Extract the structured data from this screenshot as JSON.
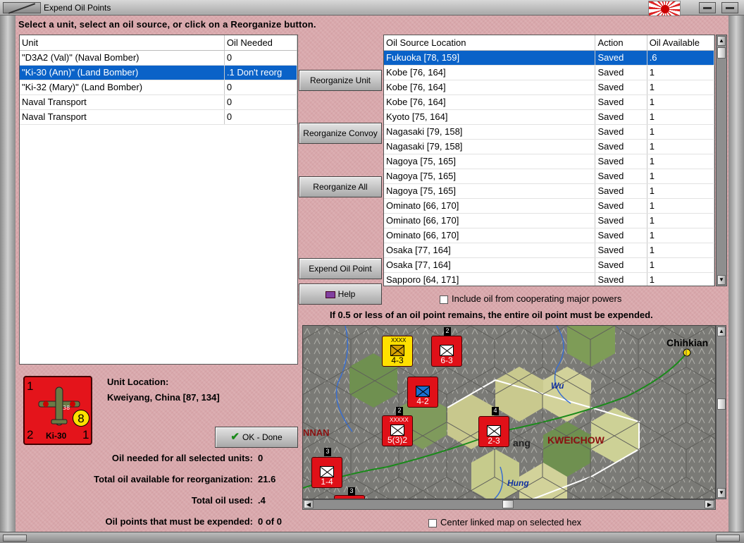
{
  "window": {
    "title": "Expend Oil Points"
  },
  "instruction": "Select a unit, select an oil source, or click on a Reorganize button.",
  "units_table": {
    "headers": [
      "Unit",
      "Oil Needed"
    ],
    "rows": [
      {
        "unit": "\"D3A2 (Val)\" (Naval Bomber)",
        "oil": "0"
      },
      {
        "unit": "\"Ki-30 (Ann)\" (Land Bomber)",
        "oil": ".1 Don't reorg"
      },
      {
        "unit": "\"Ki-32 (Mary)\" (Land Bomber)",
        "oil": "0"
      },
      {
        "unit": "Naval Transport",
        "oil": "0"
      },
      {
        "unit": "Naval Transport",
        "oil": "0"
      }
    ],
    "selected_index": 1
  },
  "buttons": {
    "reorganize_unit": "Reorganize Unit",
    "reorganize_convoy": "Reorganize Convoy",
    "reorganize_all": "Reorganize All",
    "expend_oil_point": "Expend Oil Point",
    "help": "Help",
    "ok_done": "OK - Done"
  },
  "oil_table": {
    "headers": [
      "Oil Source Location",
      "Action",
      "Oil Available"
    ],
    "rows": [
      {
        "loc": "Fukuoka [78, 159]",
        "action": "Saved",
        "avail": ".6"
      },
      {
        "loc": "Kobe [76, 164]",
        "action": "Saved",
        "avail": "1"
      },
      {
        "loc": "Kobe [76, 164]",
        "action": "Saved",
        "avail": "1"
      },
      {
        "loc": "Kobe [76, 164]",
        "action": "Saved",
        "avail": "1"
      },
      {
        "loc": "Kyoto [75, 164]",
        "action": "Saved",
        "avail": "1"
      },
      {
        "loc": "Nagasaki [79, 158]",
        "action": "Saved",
        "avail": "1"
      },
      {
        "loc": "Nagasaki [79, 158]",
        "action": "Saved",
        "avail": "1"
      },
      {
        "loc": "Nagoya [75, 165]",
        "action": "Saved",
        "avail": "1"
      },
      {
        "loc": "Nagoya [75, 165]",
        "action": "Saved",
        "avail": "1"
      },
      {
        "loc": "Nagoya [75, 165]",
        "action": "Saved",
        "avail": "1"
      },
      {
        "loc": "Ominato [66, 170]",
        "action": "Saved",
        "avail": "1"
      },
      {
        "loc": "Ominato [66, 170]",
        "action": "Saved",
        "avail": "1"
      },
      {
        "loc": "Ominato [66, 170]",
        "action": "Saved",
        "avail": "1"
      },
      {
        "loc": "Osaka [77, 164]",
        "action": "Saved",
        "avail": "1"
      },
      {
        "loc": "Osaka [77, 164]",
        "action": "Saved",
        "avail": "1"
      },
      {
        "loc": "Sapporo [64, 171]",
        "action": "Saved",
        "avail": "1"
      }
    ],
    "selected_index": 0
  },
  "include_cooperating": "Include oil from cooperating major powers",
  "note": "If 0.5 or less of an oil point remains, the entire oil point must be expended.",
  "unit_counter": {
    "tl": "1",
    "bl": "2",
    "br": "1",
    "circle": "8",
    "name": "Ki-30",
    "small": "38"
  },
  "unit_location": {
    "label": "Unit Location:",
    "value": "Kweiyang, China [87, 134]"
  },
  "stats": [
    {
      "label": "Oil needed for all selected units:",
      "value": "0"
    },
    {
      "label": "Total oil available for reorganization:",
      "value": "21.6"
    },
    {
      "label": "Total oil used:",
      "value": ".4"
    },
    {
      "label": "Oil points that must be expended:",
      "value": "0 of 0"
    }
  ],
  "map": {
    "labels": {
      "chihkiang": "Chihkian",
      "wu": "Wu",
      "kweichow": "KWEICHOW",
      "ang": "ang",
      "hung": "Hung",
      "nnan": "NNAN"
    },
    "units": [
      {
        "str": "4-3",
        "tag": "XXXX",
        "top": ""
      },
      {
        "str": "6-3",
        "tag": "",
        "top": "2"
      },
      {
        "str": "4-2",
        "tag": "",
        "top": ""
      },
      {
        "str": "5(3)2",
        "tag": "XXXXX",
        "top": "2"
      },
      {
        "str": "2-3",
        "tag": "",
        "top": "4"
      },
      {
        "str": "1-4",
        "tag": "",
        "top": "3"
      },
      {
        "str": "",
        "tag": "",
        "top": "3"
      }
    ]
  },
  "center_map": "Center linked map on selected hex"
}
